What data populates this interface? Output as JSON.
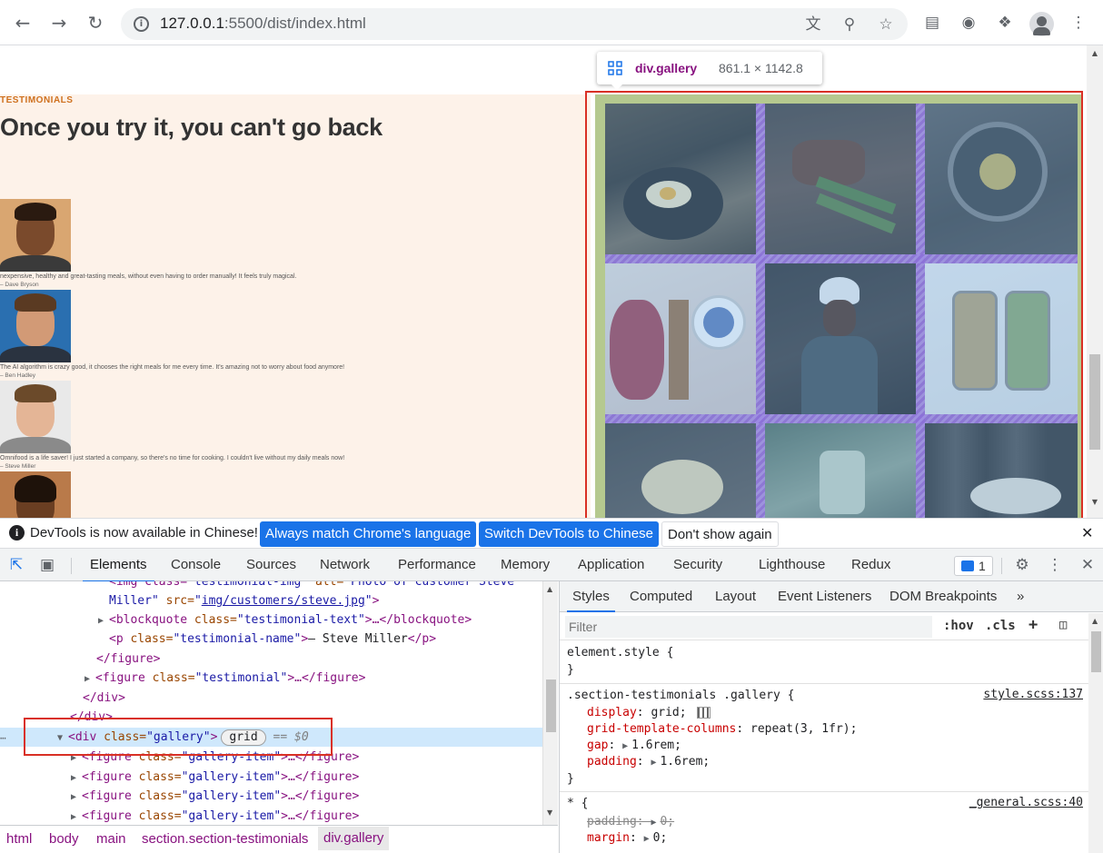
{
  "browser": {
    "url_host": "127.0.0.1",
    "url_rest": ":5500/dist/index.html"
  },
  "page": {
    "subheading": "TESTIMONIALS",
    "heading": "Once you try it, you can't go back",
    "testimonials": [
      {
        "text": "nexpensive, healthy and great-tasting meals, without even having to order manually! It feels truly magical.",
        "name": "– Dave Bryson"
      },
      {
        "text": "The AI algorithm is crazy good, it chooses the right meals for me every time. It's amazing not to worry about food anymore!",
        "name": "– Ben Hadley"
      },
      {
        "text": "Omnifood is a life saver! I just started a company, so there's no time for cooking. I couldn't live without my daily meals now!",
        "name": "– Steve Miller"
      }
    ]
  },
  "inspect_tooltip": {
    "tag": "div.gallery",
    "dims": "861.1 × 1142.8"
  },
  "infobar": {
    "message": "DevTools is now available in Chinese!",
    "btn_match": "Always match Chrome's language",
    "btn_switch": "Switch DevTools to Chinese",
    "btn_dismiss": "Don't show again"
  },
  "devtools": {
    "tabs": [
      "Elements",
      "Console",
      "Sources",
      "Network",
      "Performance",
      "Memory",
      "Application",
      "Security",
      "Lighthouse",
      "Redux"
    ],
    "issues_count": "1",
    "elements": {
      "lines": {
        "l1_a": "<img class=",
        "l1_b": "\"testimonial-img\"",
        "l1_c": " alt=",
        "l1_d": "\"Photo of customer Steve",
        "l2_a": "Miller\"",
        "l2_b": " src=",
        "l2_c": "img/customers/steve.jpg",
        "l3_tag": "<blockquote ",
        "l3_attr": "class=",
        "l3_val": "\"testimonial-text\"",
        "l3_end": ">…</blockquote>",
        "l4_tag": "<p ",
        "l4_attr": "class=",
        "l4_val": "\"testimonial-name\"",
        "l4_text": "— Steve Miller",
        "l4_end": "</p>",
        "l5": "</figure>",
        "l6_tag": "<figure ",
        "l6_attr": "class=",
        "l6_val": "\"testimonial\"",
        "l6_end": ">…</figure>",
        "l7": "</div>",
        "l8": "</div>",
        "sel_tag": "<div ",
        "sel_attr": "class=",
        "sel_val": "\"gallery\"",
        "sel_close": ">",
        "sel_badge": "grid",
        "sel_dollar": "== $0",
        "fig_tag": "<figure ",
        "fig_attr": "class=",
        "fig_val": "\"gallery-item\"",
        "fig_end": ">…</figure>"
      }
    },
    "breadcrumb": [
      "html",
      "body",
      "main",
      "section.section-testimonials",
      "div.gallery"
    ],
    "styles": {
      "subtabs": [
        "Styles",
        "Computed",
        "Layout",
        "Event Listeners",
        "DOM Breakpoints"
      ],
      "filter_placeholder": "Filter",
      "hov": ":hov",
      "cls": ".cls",
      "element_style": "element.style {",
      "close_brace": "}",
      "rule1_selector": ".section-testimonials .gallery {",
      "rule1_source": "style.scss:137",
      "rule1_props": [
        {
          "name": "display",
          "value": "grid;"
        },
        {
          "name": "grid-template-columns",
          "value": "repeat(3, 1fr);"
        },
        {
          "name": "gap",
          "value": "1.6rem;"
        },
        {
          "name": "padding",
          "value": "1.6rem;"
        }
      ],
      "rule2_selector": "* {",
      "rule2_source": "_general.scss:40",
      "rule2_props": [
        {
          "name": "padding",
          "value": "0;"
        },
        {
          "name": "margin",
          "value": "0;"
        }
      ]
    }
  },
  "colors": {
    "accent_blue": "#1a73e8",
    "highlight_red": "#d93025",
    "grid_gap_purple": "#9a52d6",
    "section_bg": "#fdf2e9"
  }
}
